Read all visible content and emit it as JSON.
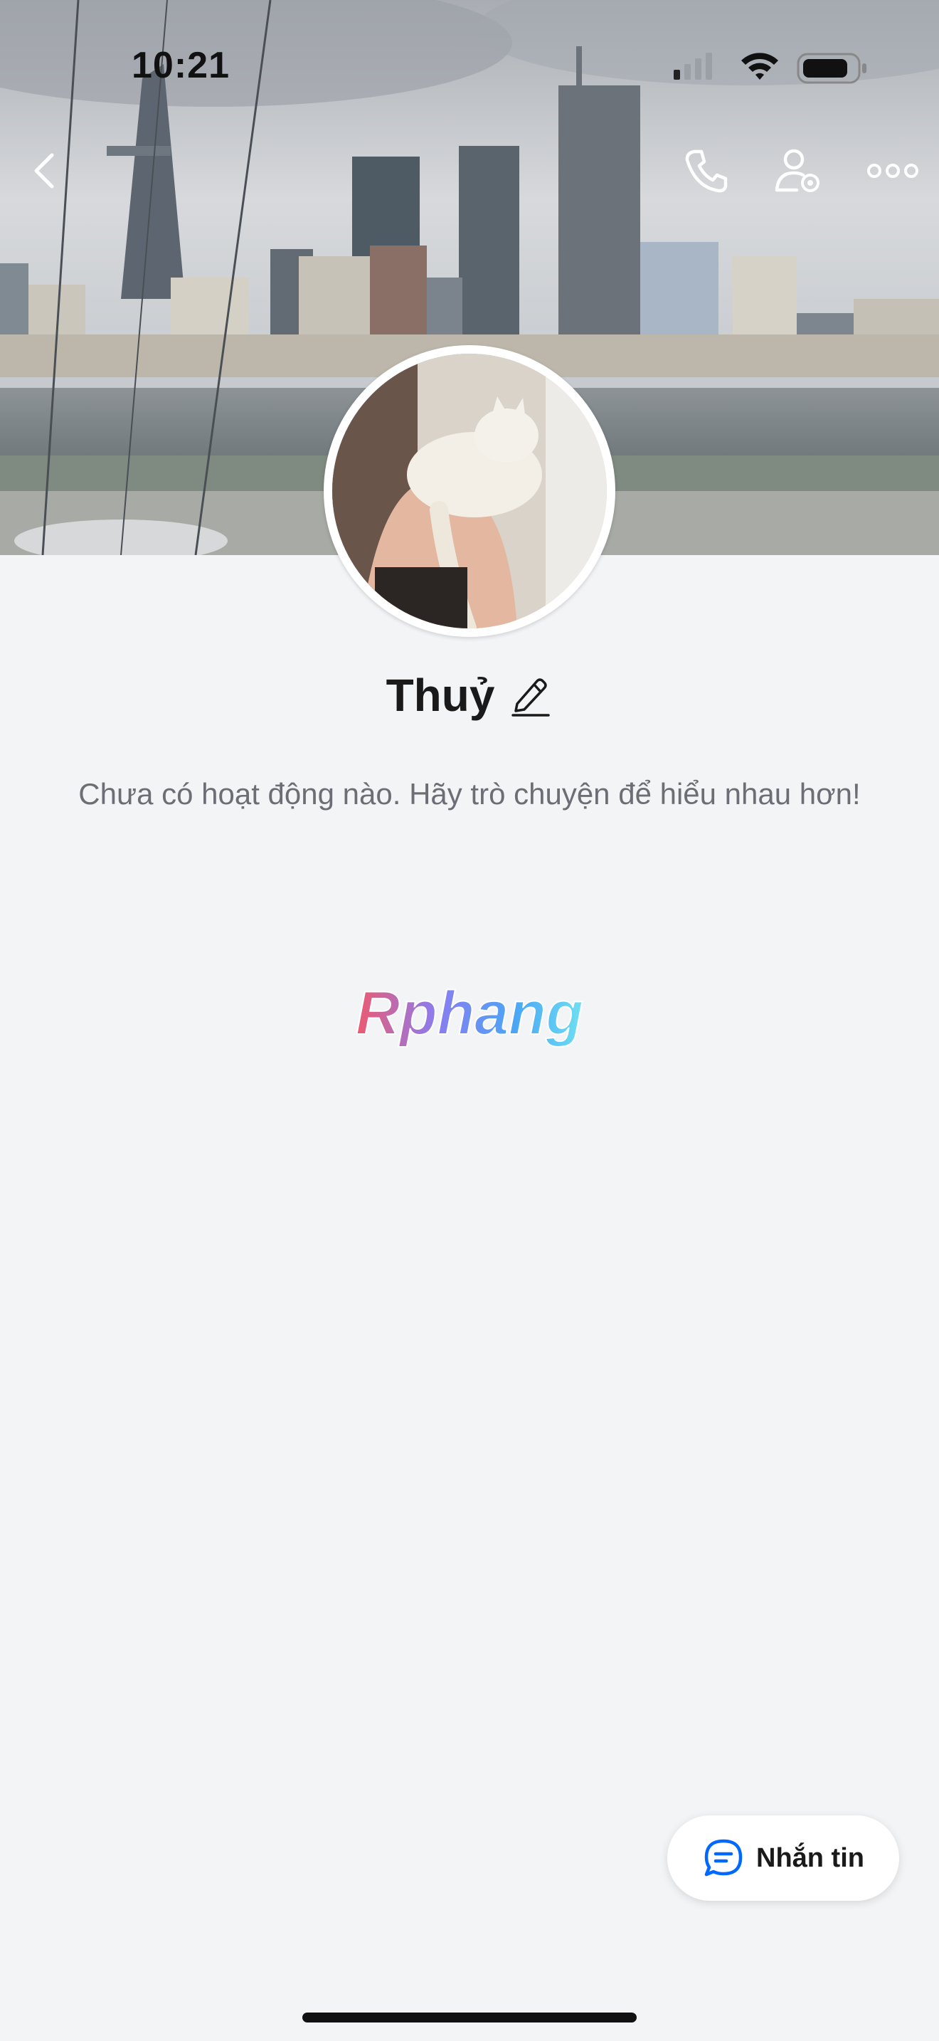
{
  "status_bar": {
    "time": "10:21"
  },
  "header": {
    "icons": [
      "back-icon",
      "phone-icon",
      "user-settings-icon",
      "more-icon"
    ]
  },
  "profile": {
    "name": "Thuỷ",
    "empty_message": "Chưa có hoạt động nào. Hãy trò chuyện để hiểu nhau hơn!",
    "watermark": "Rphang"
  },
  "actions": {
    "message_label": "Nhắn tin"
  },
  "colors": {
    "accent": "#0068ff",
    "background": "#f3f4f6"
  }
}
